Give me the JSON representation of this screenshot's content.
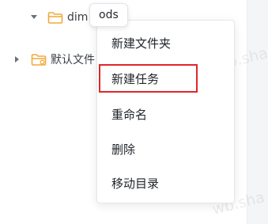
{
  "tree": {
    "nodes": [
      {
        "label": "dim",
        "icon": "folder-open-icon",
        "expanded": true
      },
      {
        "label": "默认文件",
        "icon": "folder-default-icon",
        "expanded": false
      }
    ]
  },
  "tooltip": {
    "text": "ods"
  },
  "context_menu": {
    "items": [
      {
        "label": "新建文件夹"
      },
      {
        "label": "新建任务",
        "highlighted": true
      },
      {
        "label": "重命名"
      },
      {
        "label": "删除"
      },
      {
        "label": "移动目录"
      }
    ]
  },
  "watermark": {
    "text": "wb.sha"
  },
  "colors": {
    "folder": "#f2a93b",
    "highlight_border": "#e0262c",
    "text": "#1f2329"
  }
}
